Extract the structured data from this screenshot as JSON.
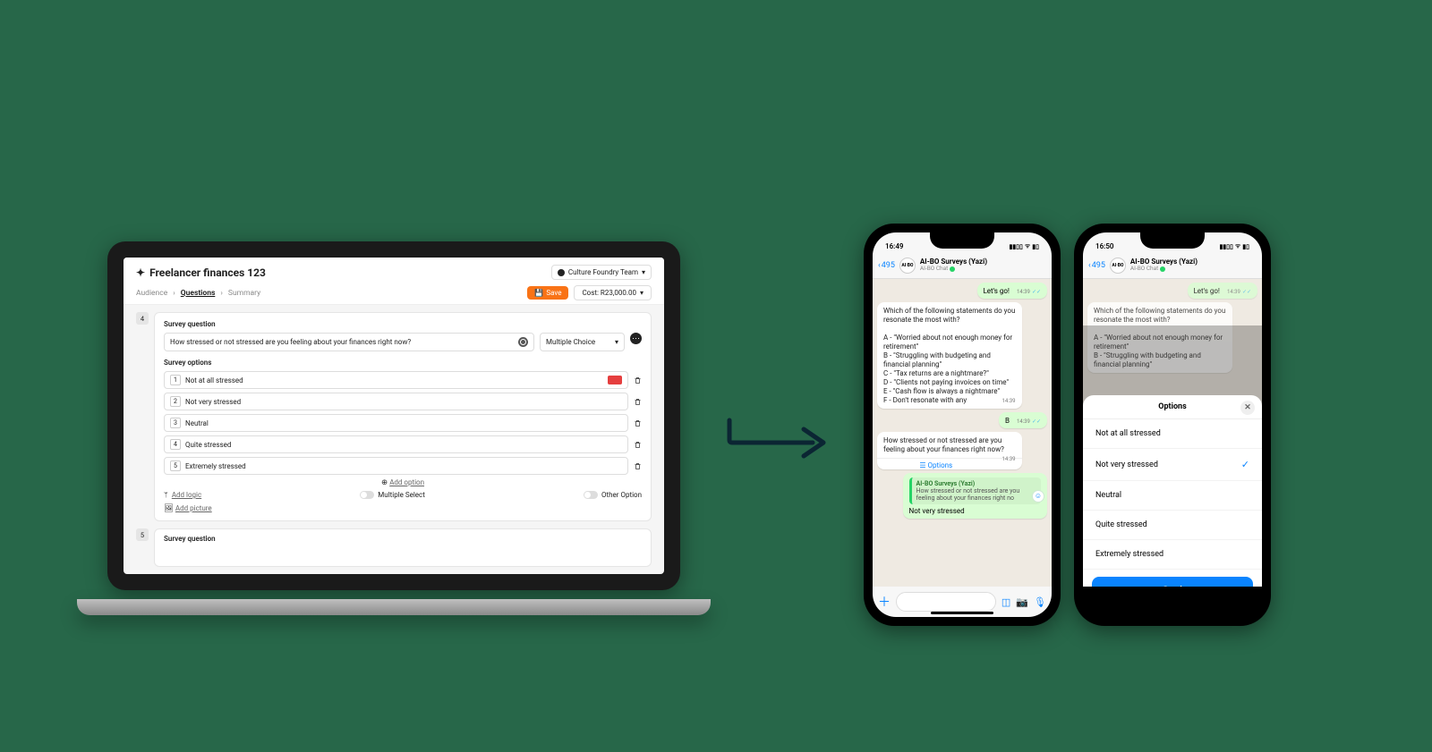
{
  "laptop": {
    "title": "Freelancer finances 123",
    "team_selector": "Culture Foundry Team",
    "breadcrumbs": {
      "audience": "Audience",
      "questions": "Questions",
      "summary": "Summary"
    },
    "save_label": "Save",
    "cost_label": "Cost: R23,000.00",
    "step_number": "4",
    "next_step_number": "5",
    "sq_label": "Survey question",
    "so_label": "Survey options",
    "question_text": "How stressed or not stressed are you feeling about your finances right now?",
    "question_type": "Multiple Choice",
    "options": [
      {
        "n": "1",
        "label": "Not at all stressed",
        "media": true
      },
      {
        "n": "2",
        "label": "Not very stressed",
        "media": false
      },
      {
        "n": "3",
        "label": "Neutral",
        "media": false
      },
      {
        "n": "4",
        "label": "Quite stressed",
        "media": false
      },
      {
        "n": "5",
        "label": "Extremely stressed",
        "media": false
      }
    ],
    "add_option_label": "Add option",
    "add_logic_label": "Add logic",
    "multiple_select_label": "Multiple Select",
    "other_option_label": "Other Option",
    "add_picture_label": "Add picture",
    "next_sq_label": "Survey question"
  },
  "phone1": {
    "time": "16:49",
    "back_count": "495",
    "contact": "AI-BO Surveys (Yazi)",
    "contact_sub": "AI-BO Chat",
    "lets_go": "Let's go!",
    "lets_go_time": "14:39",
    "q1": "Which of the following statements do you resonate the most with?\n\nA - \"Worried about not enough money for retirement\"\nB - \"Struggling with budgeting and financial planning\"\nC - \"Tax returns are a nightmare?\"\nD - \"Clients not paying invoices on time\"\nE - \"Cash flow is always a nightmare\"\nF - Don't resonate with any",
    "q1_time": "14:39",
    "answer1": "B",
    "answer1_time": "14:39",
    "q2": "How stressed or not stressed are you feeling about your finances right now?",
    "q2_time": "14:39",
    "options_label": "Options",
    "reply_title": "AI-BO Surveys (Yazi)",
    "reply_snippet": "How stressed or not stressed are you feeling about your finances right no",
    "answer2": "Not very stressed"
  },
  "phone2": {
    "time": "16:50",
    "back_count": "495",
    "contact": "AI-BO Surveys (Yazi)",
    "contact_sub": "AI-BO Chat",
    "lets_go": "Let's go!",
    "lets_go_time": "14:39",
    "q1_partial": "Which of the following statements do you resonate the most with?\n\nA - \"Worried about not enough money for retirement\"\nB - \"Struggling with budgeting and financial planning\"",
    "sheet_title": "Options",
    "sheet_options": [
      {
        "label": "Not at all stressed",
        "selected": false
      },
      {
        "label": "Not very stressed",
        "selected": true
      },
      {
        "label": "Neutral",
        "selected": false
      },
      {
        "label": "Quite stressed",
        "selected": false
      },
      {
        "label": "Extremely stressed",
        "selected": false
      }
    ],
    "send_label": "Send"
  }
}
